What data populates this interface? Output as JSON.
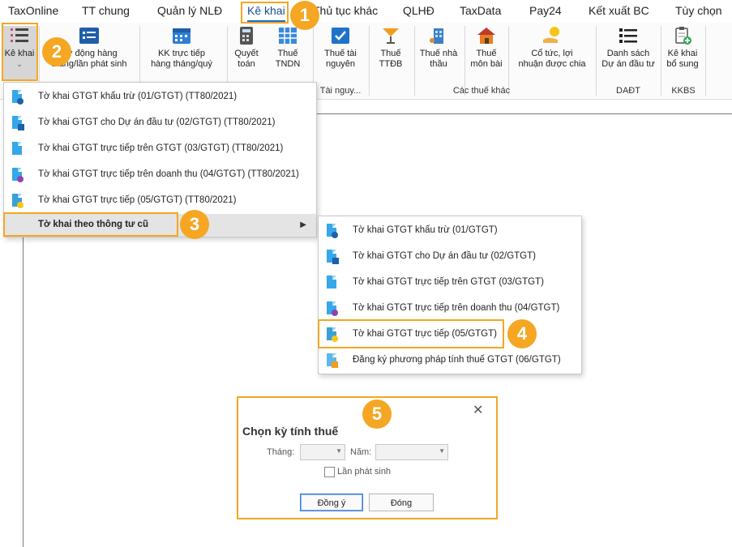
{
  "tabs": [
    "TaxOnline",
    "TT chung",
    "Quản lý NLĐ",
    "Kê khai",
    "Thủ tục khác",
    "QLHĐ",
    "TaxData",
    "Pay24",
    "Kết xuất BC",
    "Tùy chọn"
  ],
  "ribbon": {
    "ke_khai": "Kê khai",
    "tu_dong_l1": "Tự động hàng",
    "tu_dong_l2": "tháng/lần phát sinh",
    "kk_truc_tiep_l1": "KK trực tiếp",
    "kk_truc_tiep_l2": "hàng tháng/quý",
    "quyet_toan_l1": "Quyết",
    "quyet_toan_l2": "toán",
    "thue_tndn_l1": "Thuế",
    "thue_tndn_l2": "TNDN",
    "thue_tai_nguyen_l1": "Thuế tài",
    "thue_tai_nguyen_l2": "nguyên",
    "thue_ttdb_l1": "Thuế",
    "thue_ttdb_l2": "TTĐB",
    "thue_nha_thau_l1": "Thuế nhà",
    "thue_nha_thau_l2": "thầu",
    "thue_mon_bai_l1": "Thuế",
    "thue_mon_bai_l2": "môn bài",
    "co_tuc_l1": "Cổ tức, lợi",
    "co_tuc_l2": "nhuận được chia",
    "danh_sach_l1": "Danh sách",
    "danh_sach_l2": "Dự án đầu tư",
    "ke_khai_bs_l1": "Kê khai",
    "ke_khai_bs_l2": "bổ sung",
    "group_tai_nguyen": "Tài nguy...",
    "group_cac_thue_khac": "Các thuế khác",
    "group_dadt": "DAĐT",
    "group_kkbs": "KKBS"
  },
  "menu1": [
    "Tờ khai GTGT khấu trừ (01/GTGT) (TT80/2021)",
    "Tờ khai GTGT cho Dự án đầu tư (02/GTGT) (TT80/2021)",
    "Tờ khai GTGT trực tiếp trên GTGT (03/GTGT) (TT80/2021)",
    "Tờ khai GTGT trực tiếp trên doanh thu (04/GTGT) (TT80/2021)",
    "Tờ khai GTGT trực tiếp (05/GTGT) (TT80/2021)",
    "Tờ khai theo thông tư cũ"
  ],
  "menu2": [
    "Tờ khai GTGT khấu trừ (01/GTGT)",
    "Tờ khai GTGT cho Dự án đầu tư (02/GTGT)",
    "Tờ khai GTGT trực tiếp trên GTGT (03/GTGT)",
    "Tờ khai GTGT trực tiếp trên doanh thu (04/GTGT)",
    "Tờ khai GTGT trực tiếp (05/GTGT)",
    "Đăng ký phương pháp tính thuế GTGT (06/GTGT)"
  ],
  "dialog": {
    "title": "Chọn kỳ tính thuế",
    "thang_label": "Tháng:",
    "nam_label": "Năm:",
    "lan_phat_sinh": "Lần phát sinh",
    "ok": "Đồng ý",
    "close": "Đóng"
  },
  "steps": [
    "1",
    "2",
    "3",
    "4",
    "5"
  ],
  "colors": {
    "accent": "#f5a623",
    "tab_active": "#1a6fc9",
    "doc_icon": "#36a7e8"
  }
}
